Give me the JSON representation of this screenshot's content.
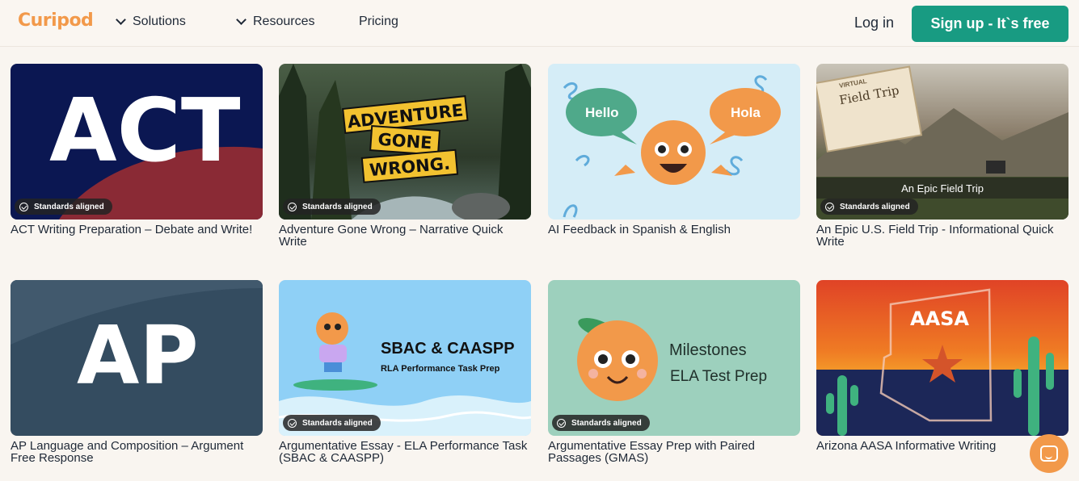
{
  "header": {
    "logo": "Curipod",
    "nav": [
      {
        "label": "Solutions",
        "has_dropdown": true
      },
      {
        "label": "Resources",
        "has_dropdown": true
      },
      {
        "label": "Pricing",
        "has_dropdown": false
      }
    ],
    "login_label": "Log in",
    "signup_label": "Sign up - It`s free"
  },
  "badge_label": "Standards aligned",
  "cards": [
    {
      "title": "ACT Writing Preparation – Debate and Write!",
      "thumb_text": "ACT",
      "standards_aligned": true
    },
    {
      "title": "Adventure Gone Wrong – Narrative Quick Write",
      "thumb_text": [
        "ADVENTURE",
        "GONE",
        "WRONG."
      ],
      "standards_aligned": true
    },
    {
      "title": "AI Feedback in Spanish & English",
      "thumb_text": [
        "Hello",
        "Hola"
      ],
      "standards_aligned": false
    },
    {
      "title": "An Epic U.S. Field Trip - Informational Quick Write",
      "thumb_text": [
        "VIRTUAL",
        "Field Trip",
        "An Epic Field Trip"
      ],
      "standards_aligned": true
    },
    {
      "title": "AP Language and Composition – Argument Free Response",
      "thumb_text": "AP",
      "standards_aligned": false
    },
    {
      "title": "Argumentative Essay - ELA Performance Task (SBAC & CAASPP)",
      "thumb_text": [
        "SBAC & CAASPP",
        "RLA Performance Task Prep"
      ],
      "standards_aligned": true
    },
    {
      "title": "Argumentative Essay Prep with Paired Passages (GMAS)",
      "thumb_text": [
        "Milestones",
        "ELA Test Prep"
      ],
      "standards_aligned": true
    },
    {
      "title": "Arizona AASA Informative Writing",
      "thumb_text": "AASA",
      "standards_aligned": false
    }
  ],
  "colors": {
    "accent": "#f2994a",
    "brand_green": "#189b82"
  },
  "chat_button_icon": "chat-icon"
}
